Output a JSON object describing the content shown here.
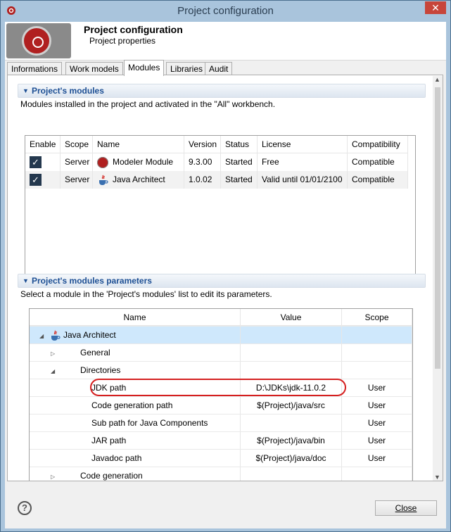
{
  "window": {
    "title": "Project configuration",
    "close_glyph": "✕"
  },
  "header": {
    "title": "Project configuration",
    "subtitle": "Project properties"
  },
  "tabs": [
    {
      "label": "Informations"
    },
    {
      "label": "Work models"
    },
    {
      "label": "Modules"
    },
    {
      "label": "Libraries"
    },
    {
      "label": "Audit"
    }
  ],
  "modules_section": {
    "title": "Project's modules",
    "description": "Modules installed in the project and activated in the \"All\" workbench.",
    "columns": [
      "Enable",
      "Scope",
      "Name",
      "Version",
      "Status",
      "License",
      "Compatibility"
    ],
    "rows": [
      {
        "enabled": "✓",
        "scope": "Server",
        "name": "Modeler Module",
        "version": "9.3.00",
        "status": "Started",
        "license": "Free",
        "compatibility": "Compatible"
      },
      {
        "enabled": "✓",
        "scope": "Server",
        "name": "Java Architect",
        "version": "1.0.02",
        "status": "Started",
        "license": "Valid until 01/01/2100",
        "compatibility": "Compatible"
      }
    ]
  },
  "params_section": {
    "title": "Project's modules parameters",
    "description": "Select a module in the 'Project's modules' list to edit its parameters.",
    "columns": [
      "Name",
      "Value",
      "Scope"
    ],
    "rows": [
      {
        "name": "Java Architect",
        "value": "",
        "scope": ""
      },
      {
        "name": "General",
        "value": "",
        "scope": ""
      },
      {
        "name": "Directories",
        "value": "",
        "scope": ""
      },
      {
        "name": "JDK path",
        "value": "D:\\JDKs\\jdk-11.0.2",
        "scope": "User"
      },
      {
        "name": "Code generation path",
        "value": "$(Project)/java/src",
        "scope": "User"
      },
      {
        "name": "Sub path for Java Components",
        "value": "",
        "scope": "User"
      },
      {
        "name": "JAR path",
        "value": "$(Project)/java/bin",
        "scope": "User"
      },
      {
        "name": "Javadoc path",
        "value": "$(Project)/java/doc",
        "scope": "User"
      },
      {
        "name": "Code generation",
        "value": "",
        "scope": ""
      }
    ]
  },
  "footer": {
    "help_glyph": "?",
    "close_label": "Close"
  },
  "colors": {
    "accent": "#1d4f94",
    "selection": "#cfe8fc",
    "highlight": "#d51f1f"
  }
}
